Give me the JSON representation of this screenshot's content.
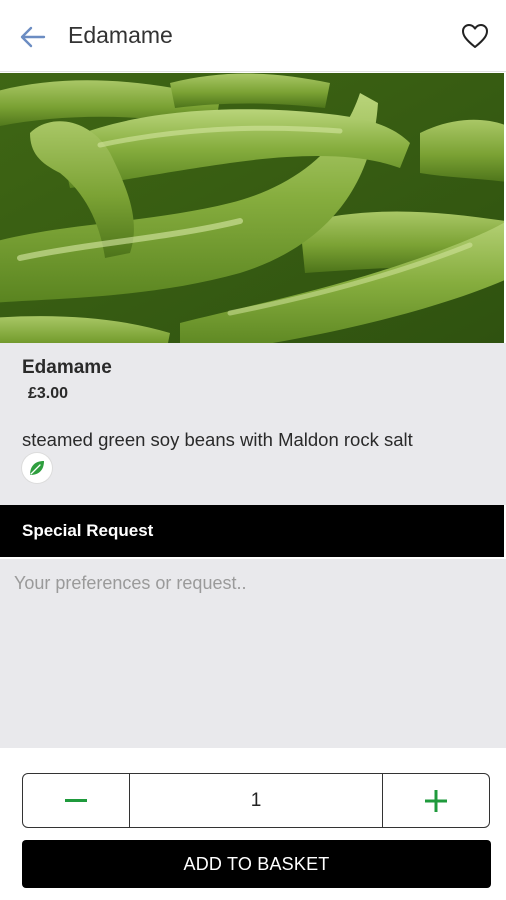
{
  "header": {
    "title": "Edamame",
    "back_icon": "arrow-left-icon",
    "favorite_icon": "heart-outline-icon"
  },
  "hero": {
    "image": "edamame-photo",
    "accent": "#6f9a2d"
  },
  "item": {
    "name": "Edamame",
    "price": "£3.00",
    "description": "steamed green soy beans with Maldon rock salt",
    "diet_icon": "leaf-icon",
    "diet_color": "#2e9e3e"
  },
  "special_request": {
    "heading": "Special Request",
    "placeholder": "Your preferences or request.."
  },
  "quantity": {
    "value": "1",
    "minus_icon": "minus-icon",
    "plus_icon": "plus-icon",
    "control_color": "#1f9a3c"
  },
  "cart": {
    "add_label": "ADD TO BASKET"
  }
}
